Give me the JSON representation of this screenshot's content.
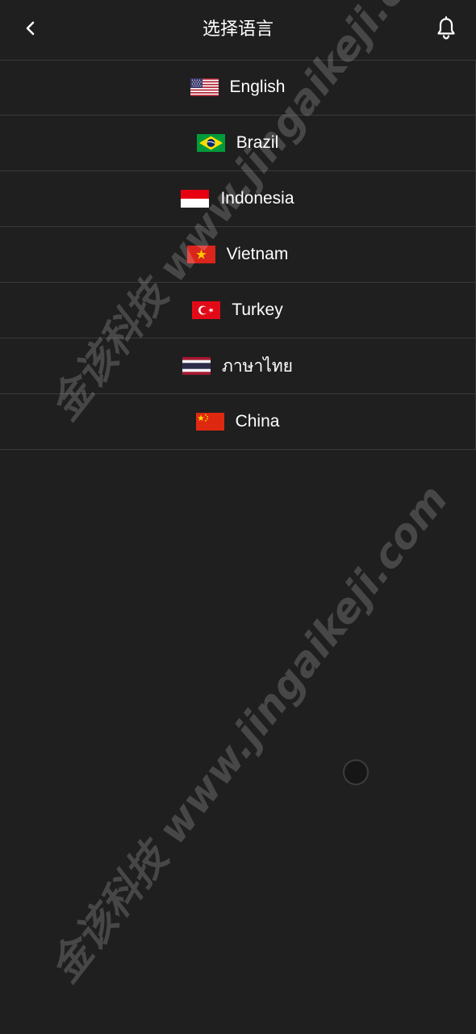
{
  "header": {
    "title": "选择语言",
    "back_icon": "chevron-left-icon",
    "bell_icon": "bell-icon"
  },
  "languages": [
    {
      "label": "English",
      "flag": "us-flag-icon"
    },
    {
      "label": "Brazil",
      "flag": "brazil-flag-icon"
    },
    {
      "label": "Indonesia",
      "flag": "indonesia-flag-icon"
    },
    {
      "label": "Vietnam",
      "flag": "vietnam-flag-icon"
    },
    {
      "label": "Turkey",
      "flag": "turkey-flag-icon"
    },
    {
      "label": "ภาษาไทย",
      "flag": "thailand-flag-icon"
    },
    {
      "label": "China",
      "flag": "china-flag-icon"
    }
  ],
  "watermark": {
    "text": "金该科技 www.jingaikeji.com"
  },
  "colors": {
    "background": "#1f1f1f",
    "divider": "#3a3a3a",
    "text": "#ffffff"
  }
}
